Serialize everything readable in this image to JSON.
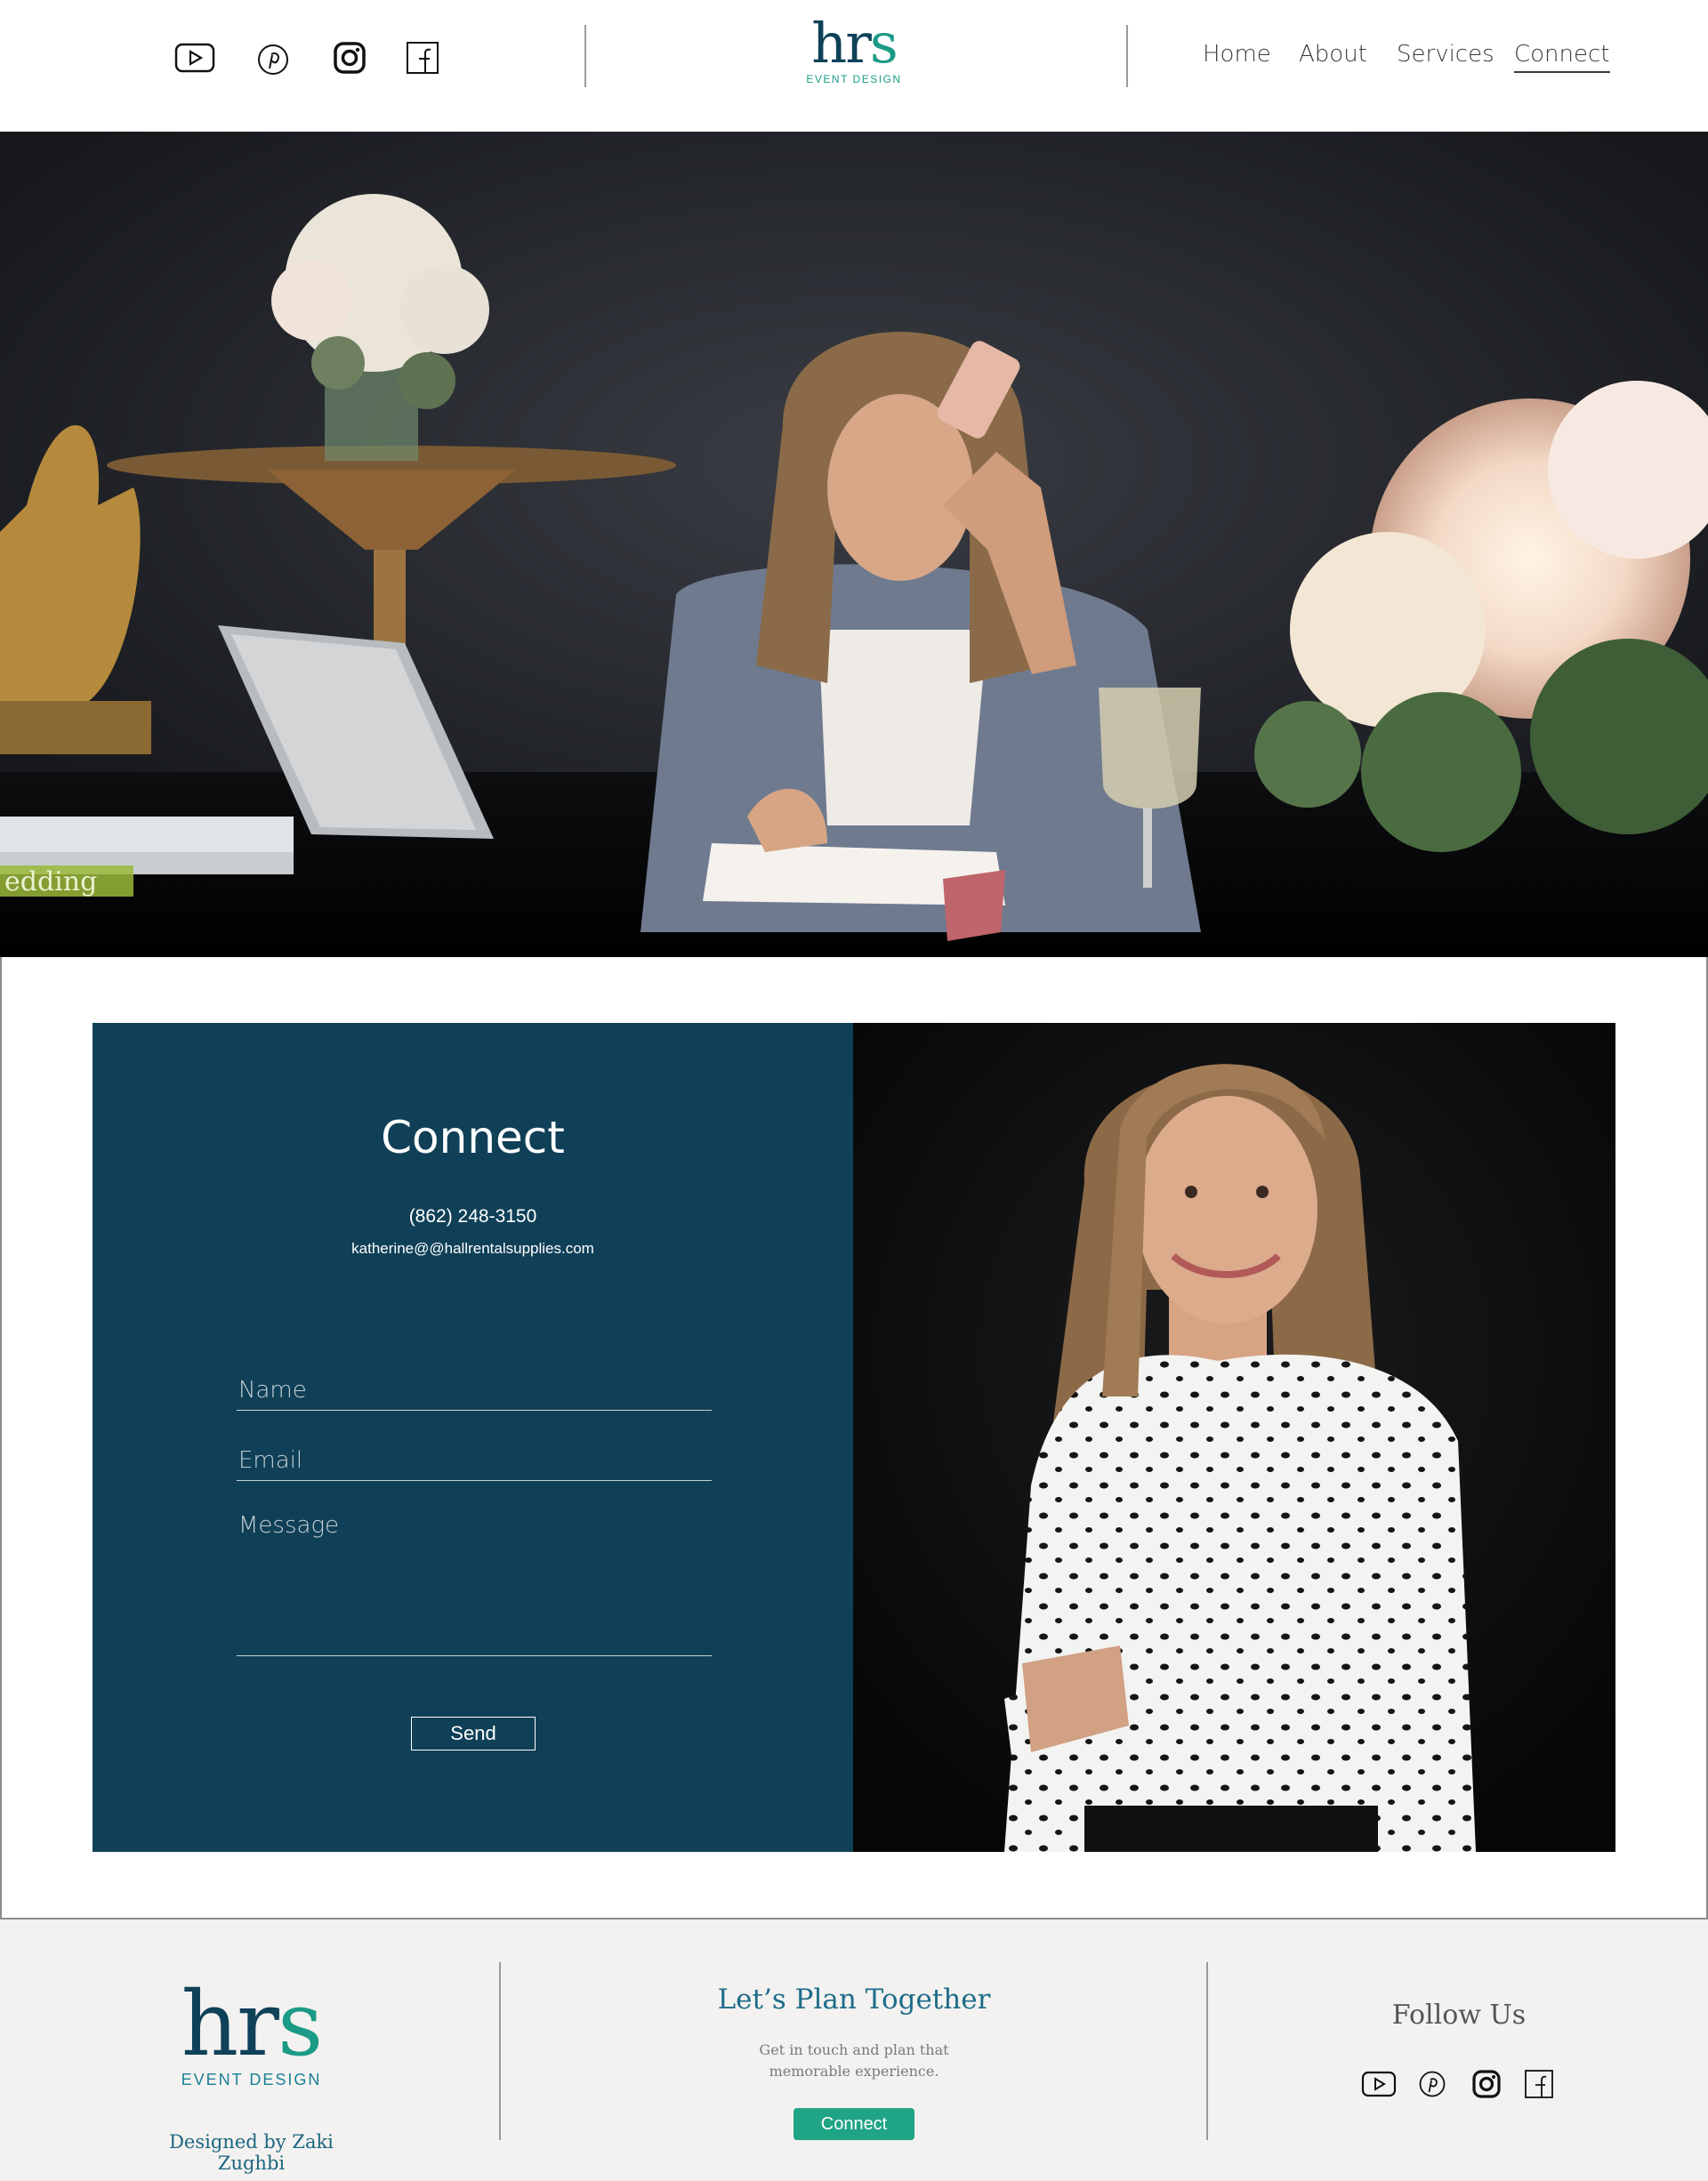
{
  "header": {
    "logo_text": "hrs",
    "logo_sub": "EVENT DESIGN",
    "social_icons": [
      "youtube-icon",
      "pinterest-icon",
      "instagram-icon",
      "facebook-icon"
    ],
    "nav": [
      {
        "label": "Home",
        "active": false
      },
      {
        "label": "About",
        "active": false
      },
      {
        "label": "Services",
        "active": false
      },
      {
        "label": "Connect",
        "active": true
      }
    ]
  },
  "hero": {
    "book_spine_text": "edding"
  },
  "contact": {
    "title": "Connect",
    "phone": "(862) 248-3150",
    "email": "katherine@@hallrentalsupplies.com",
    "name_placeholder": "Name",
    "email_placeholder": "Email",
    "message_placeholder": "Message",
    "send_label": "Send"
  },
  "footer": {
    "logo_text": "hrs",
    "logo_sub": "EVENT DESIGN",
    "designed_by": "Designed by Zaki Zughbi",
    "plan_title": "Let’s Plan Together",
    "plan_text": "Get in touch and plan that memorable experience.",
    "plan_button": "Connect",
    "follow_title": "Follow Us",
    "social_icons": [
      "youtube-icon",
      "pinterest-icon",
      "instagram-icon",
      "facebook-icon"
    ]
  },
  "colors": {
    "panel": "#104057",
    "accent_teal": "#1fa485",
    "brand_navy": "#0f4159",
    "footer_bg": "#f3f2f0"
  }
}
